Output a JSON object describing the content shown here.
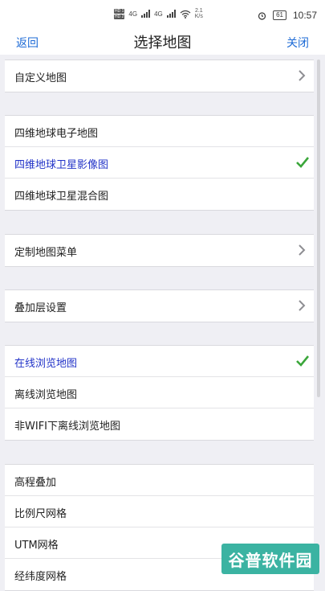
{
  "status_bar": {
    "hd1": "HD 1",
    "hd2": "HD 2",
    "net1": "4G",
    "net2": "4G",
    "speed_value": "2.1",
    "speed_unit": "K/s",
    "battery": "61",
    "time": "10:57"
  },
  "nav": {
    "back": "返回",
    "title": "选择地图",
    "close": "关闭"
  },
  "groups": [
    {
      "items": [
        {
          "label": "自定义地图",
          "accessory": "chevron",
          "selected": false
        }
      ]
    },
    {
      "items": [
        {
          "label": "四维地球电子地图",
          "accessory": "none",
          "selected": false
        },
        {
          "label": "四维地球卫星影像图",
          "accessory": "check",
          "selected": true
        },
        {
          "label": "四维地球卫星混合图",
          "accessory": "none",
          "selected": false
        }
      ]
    },
    {
      "items": [
        {
          "label": "定制地图菜单",
          "accessory": "chevron",
          "selected": false
        }
      ]
    },
    {
      "items": [
        {
          "label": "叠加层设置",
          "accessory": "chevron",
          "selected": false
        }
      ]
    },
    {
      "items": [
        {
          "label": "在线浏览地图",
          "accessory": "check",
          "selected": true
        },
        {
          "label": "离线浏览地图",
          "accessory": "none",
          "selected": false
        },
        {
          "label": "非WIFI下离线浏览地图",
          "accessory": "none",
          "selected": false
        }
      ]
    },
    {
      "items": [
        {
          "label": "高程叠加",
          "accessory": "none",
          "selected": false
        },
        {
          "label": "比例尺网格",
          "accessory": "none",
          "selected": false
        },
        {
          "label": "UTM网格",
          "accessory": "none",
          "selected": false
        },
        {
          "label": "经纬度网格",
          "accessory": "none",
          "selected": false
        }
      ]
    }
  ],
  "watermark": "谷普软件园",
  "colors": {
    "accent": "#1e6bd6",
    "selected_text": "#2233c8",
    "check": "#3aa63a",
    "background": "#efeff4",
    "watermark_bg": "#3bb3a2"
  }
}
